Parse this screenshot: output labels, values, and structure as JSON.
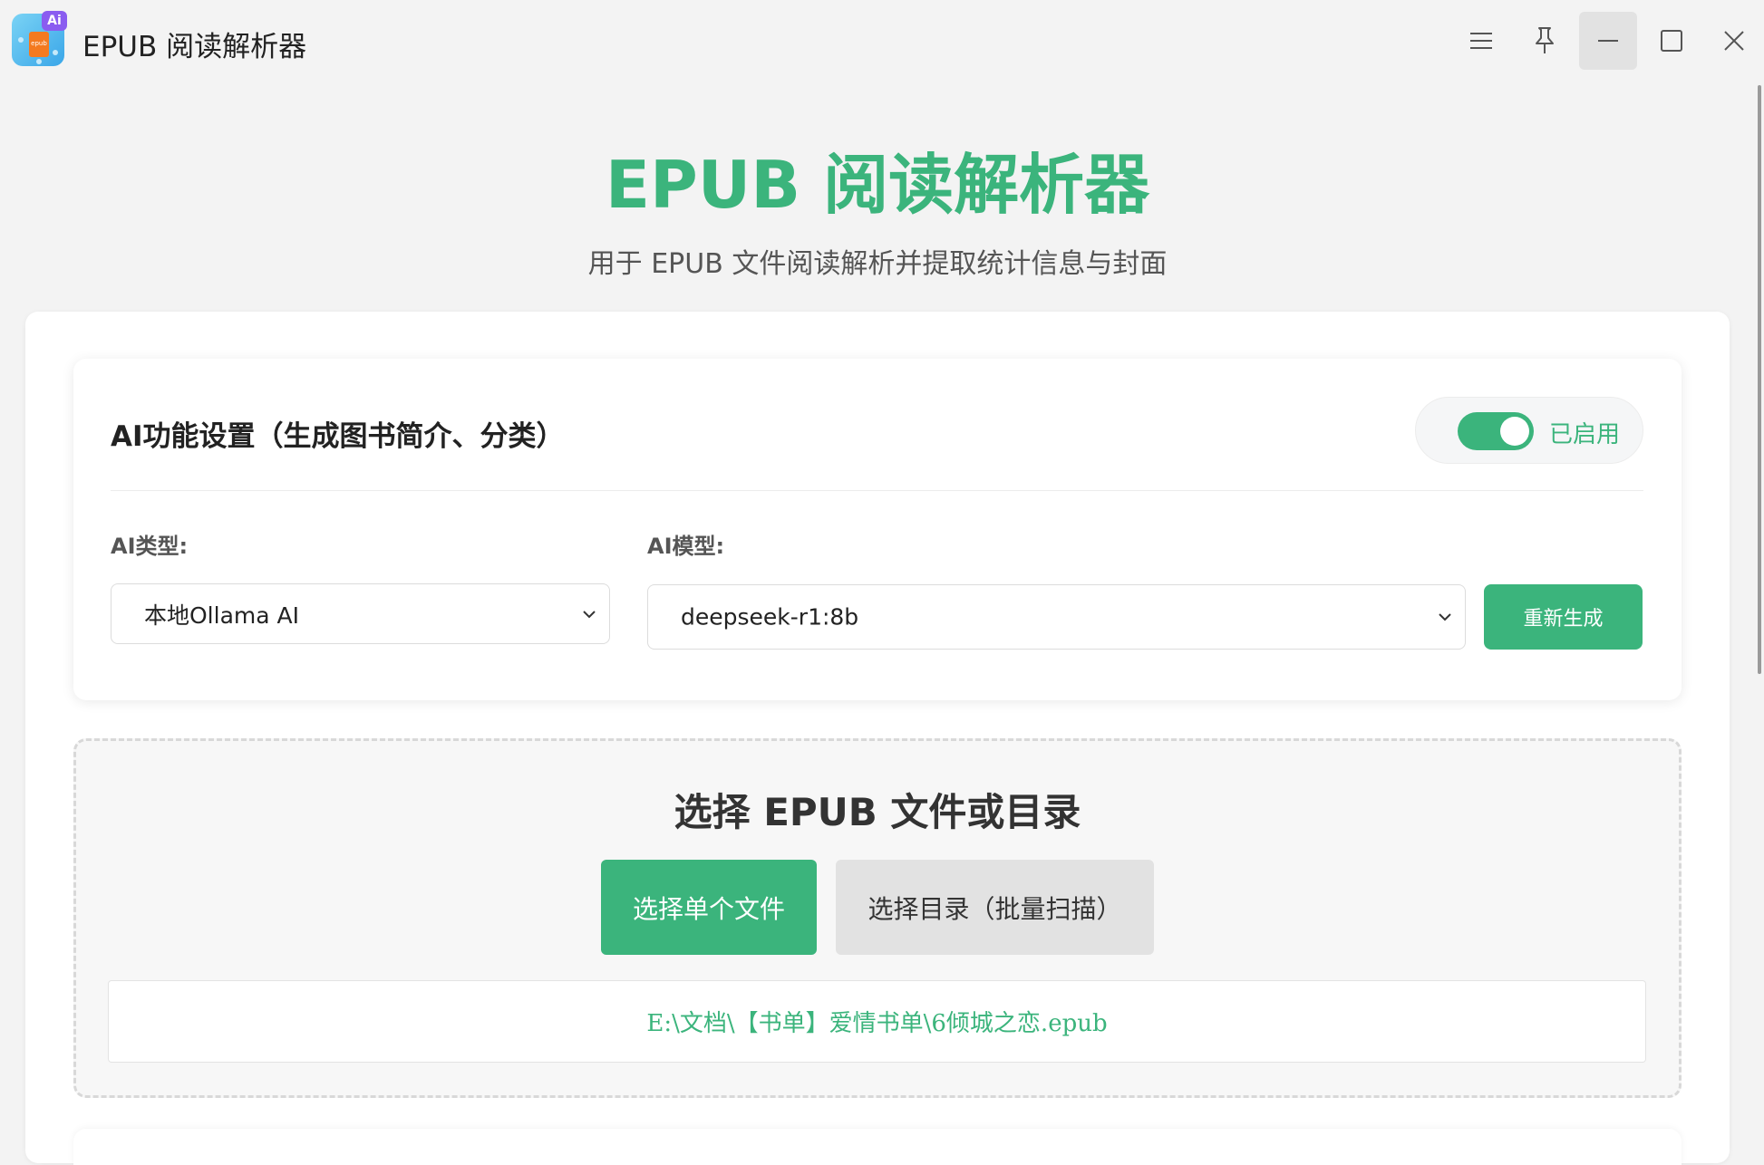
{
  "window": {
    "title": "EPUB 阅读解析器",
    "logo_badge": "Ai",
    "logo_doc": "epub"
  },
  "header": {
    "title": "EPUB 阅读解析器",
    "subtitle": "用于 EPUB 文件阅读解析并提取统计信息与封面"
  },
  "ai_settings": {
    "title": "AI功能设置（生成图书简介、分类）",
    "toggle_label": "已启用",
    "toggle_on": true,
    "type_label": "AI类型:",
    "type_value": "本地Ollama AI",
    "model_label": "AI模型:",
    "model_value": "deepseek-r1:8b",
    "regenerate_label": "重新生成"
  },
  "file_select": {
    "title": "选择 EPUB 文件或目录",
    "single_file_label": "选择单个文件",
    "directory_label": "选择目录（批量扫描）",
    "selected_path": "E:\\文档\\【书单】爱情书单\\6倾城之恋.epub"
  },
  "colors": {
    "accent": "#3bb47c",
    "background": "#f3f3f3",
    "secondary_button": "#e2e2e2"
  },
  "icons": {
    "menu": "menu-icon",
    "pin": "pin-icon",
    "minimize": "minimize-icon",
    "maximize": "maximize-icon",
    "close": "close-icon",
    "chevron": "chevron-down-icon"
  }
}
